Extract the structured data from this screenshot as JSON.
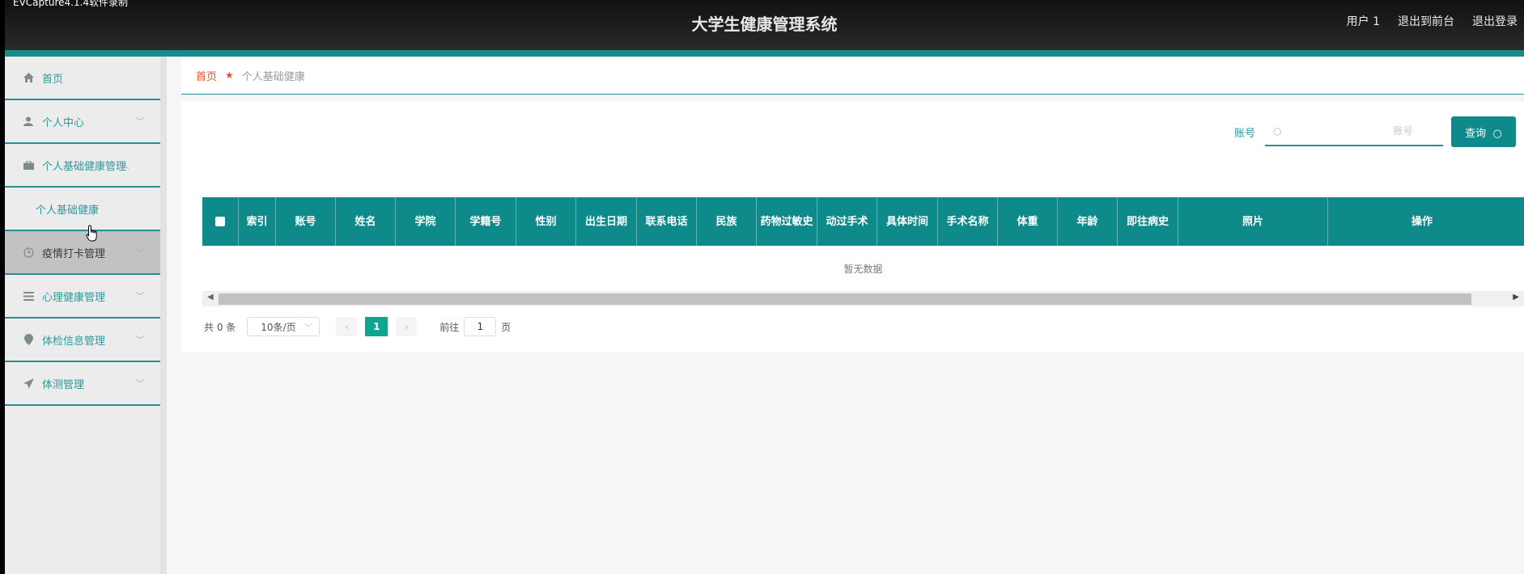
{
  "watermark": "EVCapture4.1.4软件录制",
  "header": {
    "title": "大学生健康管理系统",
    "links": [
      "用户 1",
      "退出到前台",
      "退出登录"
    ]
  },
  "sidebar": {
    "items": [
      {
        "label": "首页",
        "icon": "home-icon"
      },
      {
        "label": "个人中心",
        "icon": "user-icon"
      },
      {
        "label": "个人基础健康管理",
        "icon": "briefcase-icon",
        "expanded": true,
        "sub": [
          "个人基础健康"
        ]
      },
      {
        "label": "疫情打卡管理",
        "icon": "clock-icon"
      },
      {
        "label": "心理健康管理",
        "icon": "list-icon"
      },
      {
        "label": "体检信息管理",
        "icon": "location-icon"
      },
      {
        "label": "体测管理",
        "icon": "send-icon"
      }
    ]
  },
  "breadcrumb": {
    "home": "首页",
    "current": "个人基础健康"
  },
  "search": {
    "label": "账号",
    "placeholder": "账号",
    "value": "",
    "button": "查询"
  },
  "table": {
    "columns": [
      "索引",
      "账号",
      "姓名",
      "学院",
      "学籍号",
      "性别",
      "出生日期",
      "联系电话",
      "民族",
      "药物过敏史",
      "动过手术",
      "具体时间",
      "手术名称",
      "体重",
      "年龄",
      "即往病史",
      "照片",
      "操作"
    ],
    "empty_text": "暂无数据"
  },
  "pagination": {
    "total_text": "共 0 条",
    "page_size": "10条/页",
    "current_page": "1",
    "goto_prefix": "前往",
    "goto_value": "1",
    "goto_suffix": "页"
  },
  "colors": {
    "accent": "#0f8a8a",
    "active_page": "#0fa58e",
    "breadcrumb_home": "#e0502a"
  }
}
